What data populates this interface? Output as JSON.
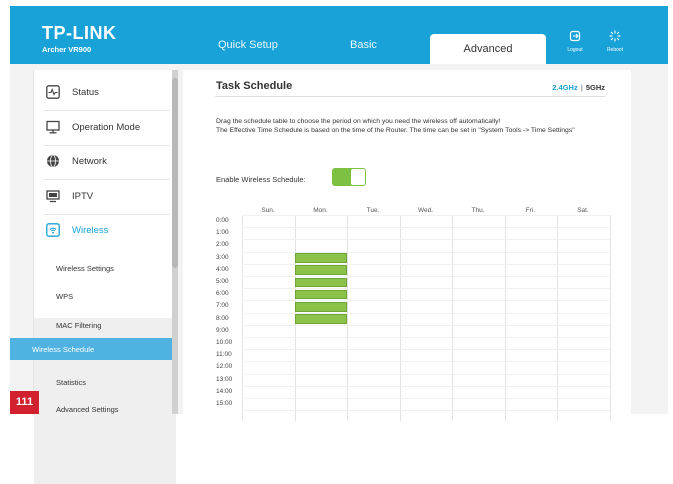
{
  "header": {
    "brand": "TP-LINK",
    "model": "Archer VR900",
    "tabs": [
      {
        "label": "Quick Setup"
      },
      {
        "label": "Basic"
      },
      {
        "label": "Advanced"
      }
    ],
    "logout_label": "Logout",
    "reboot_label": "Reboot",
    "colors": {
      "header_bg": "#19a2d7",
      "accent": "#19a2d7"
    }
  },
  "sidebar": {
    "items": [
      {
        "label": "Status",
        "icon": "pulse-icon"
      },
      {
        "label": "Operation Mode",
        "icon": "monitor-icon"
      },
      {
        "label": "Network",
        "icon": "globe-icon"
      },
      {
        "label": "IPTV",
        "icon": "tv-icon"
      },
      {
        "label": "Wireless",
        "icon": "wireless-icon"
      }
    ],
    "subitems": [
      {
        "label": "Wireless Settings"
      },
      {
        "label": "WPS"
      },
      {
        "label": "MAC Filtering"
      },
      {
        "label": "Wireless Schedule"
      },
      {
        "label": "Statistics"
      },
      {
        "label": "Advanced Settings"
      }
    ],
    "active_subitem": "Wireless Schedule"
  },
  "main": {
    "title": "Task Schedule",
    "band_24": "2.4GHz",
    "band_sep": "|",
    "band_5": "5GHz",
    "description_line1": "Drag the schedule table to choose the period on which you need the wireless off automatically!",
    "description_line2": "The Effective Time Schedule is based on the time of the Router. The time can be set in \"System Tools -> Time Settings\"",
    "enable_label": "Enable Wireless Schedule:",
    "enable_state": "on",
    "schedule": {
      "days": [
        "Sun.",
        "Mon.",
        "Tue.",
        "Wed.",
        "Thu.",
        "Fri.",
        "Sat."
      ],
      "times": [
        "0:00",
        "1:00",
        "2:00",
        "3:00",
        "4:00",
        "5:00",
        "6:00",
        "7:00",
        "8:00",
        "9:00",
        "10:00",
        "11:00",
        "12:00",
        "13:00",
        "14:00",
        "15:00"
      ],
      "selected": [
        {
          "day": "Mon.",
          "from": "3:00",
          "to": "4:00"
        },
        {
          "day": "Mon.",
          "from": "4:00",
          "to": "5:00"
        },
        {
          "day": "Mon.",
          "from": "5:00",
          "to": "6:00"
        },
        {
          "day": "Mon.",
          "from": "6:00",
          "to": "7:00"
        },
        {
          "day": "Mon.",
          "from": "7:00",
          "to": "8:00"
        },
        {
          "day": "Mon.",
          "from": "8:00",
          "to": "9:00"
        }
      ],
      "selected_color": "#8bc34a"
    }
  },
  "page_number": "111",
  "page_number_color": "#d2202f"
}
